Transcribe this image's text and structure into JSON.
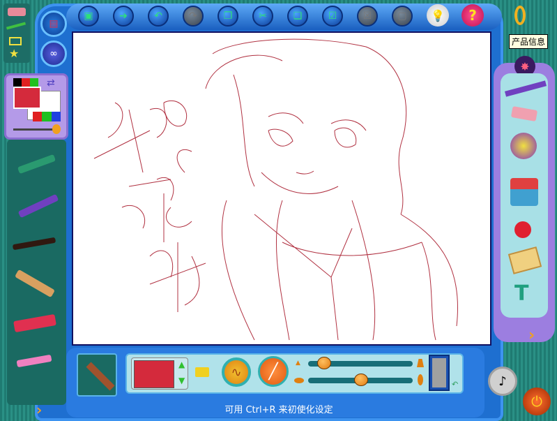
{
  "toolbar": {
    "buttons": [
      {
        "name": "new",
        "glyph": "▣",
        "enabled": true
      },
      {
        "name": "open",
        "glyph": "➔",
        "enabled": true
      },
      {
        "name": "undo",
        "glyph": "↶",
        "enabled": true
      },
      {
        "name": "redo",
        "glyph": "↷",
        "enabled": false
      },
      {
        "name": "copy",
        "glyph": "❐",
        "enabled": true
      },
      {
        "name": "cut",
        "glyph": "✂",
        "enabled": true
      },
      {
        "name": "paste",
        "glyph": "❏",
        "enabled": true
      },
      {
        "name": "select",
        "glyph": "☑",
        "enabled": true
      },
      {
        "name": "delete",
        "glyph": "☒",
        "enabled": false
      },
      {
        "name": "crop",
        "glyph": "▢",
        "enabled": false
      }
    ],
    "hint_glyph": "💡",
    "help_glyph": "?"
  },
  "tooltip": "产品信息",
  "colors": {
    "current": "#d42a3c",
    "swatches": [
      "#000000",
      "#e02020",
      "#20c020",
      "#e02020",
      "#20c020",
      "#2040e0"
    ],
    "accent": "#1e6fd0"
  },
  "bottom": {
    "status": "可用 Ctrl+R 来初使化设定",
    "size_slider": 0.1,
    "opacity_slider": 0.51
  },
  "right_tools": [
    "brush",
    "eraser",
    "sprayer",
    "paint-bucket",
    "dropper",
    "stamps",
    "glue"
  ],
  "left_tools": [
    "crayon",
    "airbrush",
    "brush",
    "paintbrush",
    "marker",
    "chalk"
  ]
}
